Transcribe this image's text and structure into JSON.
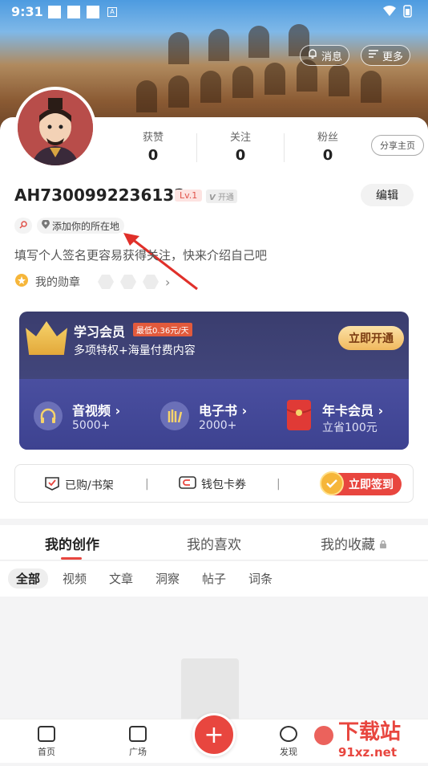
{
  "status": {
    "time": "9:31",
    "a_label": "A"
  },
  "header": {
    "messages_label": "消息",
    "more_label": "更多"
  },
  "stats": [
    {
      "label": "获赞",
      "value": "0"
    },
    {
      "label": "关注",
      "value": "0"
    },
    {
      "label": "粉丝",
      "value": "0"
    }
  ],
  "profile": {
    "share_label": "分享主页",
    "username": "AH7300992236132",
    "level": "Lv.1",
    "vip_tag": "开通",
    "edit_label": "编辑",
    "location_label": "添加你的所在地",
    "bio_placeholder": "填写个人签名更容易获得关注，快来介绍自己吧",
    "medals_label": "我的勋章"
  },
  "vip": {
    "title": "学习会员",
    "badge": "最低0.36元/天",
    "subtitle": "多项特权+海量付费内容",
    "open_label": "立即开通",
    "features": [
      {
        "title": "音视频",
        "sub": "5000+"
      },
      {
        "title": "电子书",
        "sub": "2000+"
      },
      {
        "title": "年卡会员",
        "sub": "立省100元"
      }
    ]
  },
  "shelf": {
    "purchased_label": "已购/书架",
    "wallet_label": "钱包卡券",
    "sign_label": "立即签到",
    "sep": "|"
  },
  "tabs": [
    "我的创作",
    "我的喜欢",
    "我的收藏"
  ],
  "subtabs": [
    "全部",
    "视频",
    "文章",
    "洞察",
    "帖子",
    "词条"
  ],
  "nav": {
    "home": "首页",
    "square": "广场",
    "plus": "+",
    "discover": "发现"
  },
  "watermark": {
    "text1": "下载站",
    "text2": "91xz.net"
  },
  "colors": {
    "accent": "#e8463f",
    "vip_bg": "#41457a",
    "gold": "#f0b95e"
  }
}
